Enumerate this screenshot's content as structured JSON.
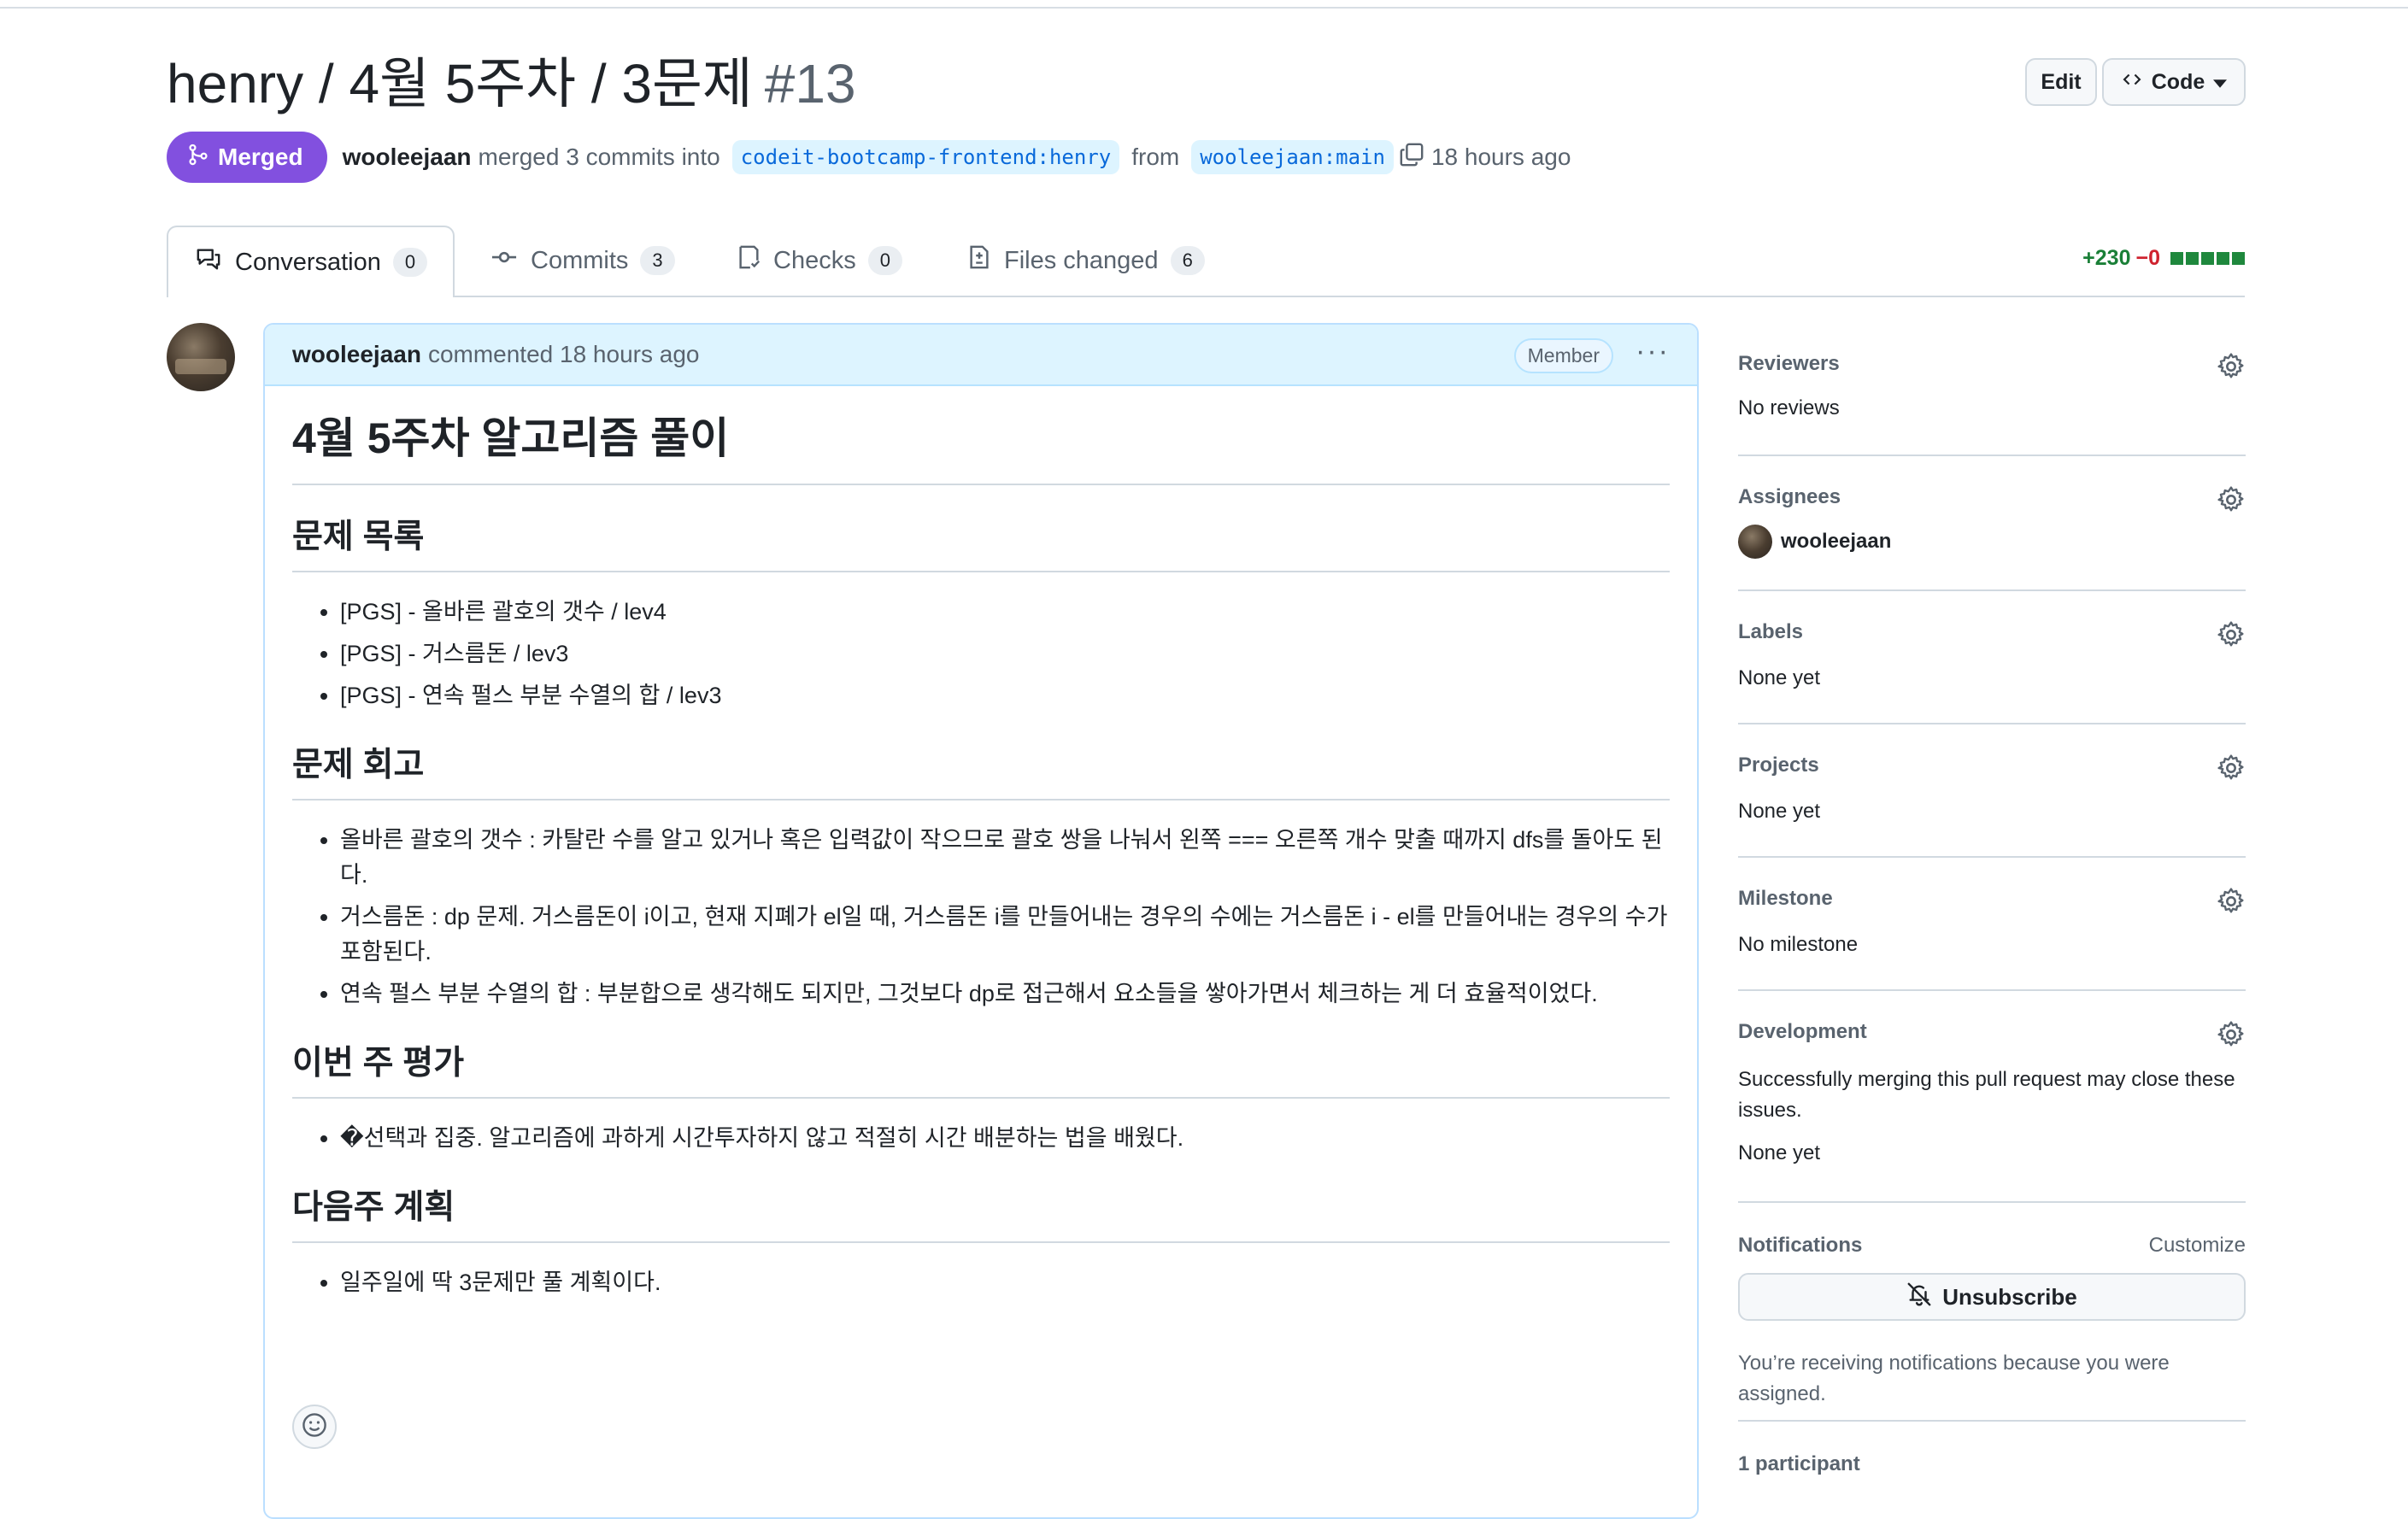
{
  "pr": {
    "title": "henry / 4월 5주차 / 3문제",
    "number": "#13",
    "status": "Merged",
    "author": "wooleejaan",
    "merged_text": "merged 3 commits into",
    "base_branch": "codeit-bootcamp-frontend:henry",
    "from_text": "from",
    "head_branch": "wooleejaan:main",
    "time": "18 hours ago",
    "edit_label": "Edit",
    "code_label": "Code"
  },
  "tabs": [
    {
      "label": "Conversation",
      "count": "0"
    },
    {
      "label": "Commits",
      "count": "3"
    },
    {
      "label": "Checks",
      "count": "0"
    },
    {
      "label": "Files changed",
      "count": "6"
    }
  ],
  "diffstat": {
    "additions": "+230",
    "deletions": "−0"
  },
  "comment": {
    "author": "wooleejaan",
    "action": "commented 18 hours ago",
    "badge": "Member",
    "h1": "4월 5주차 알고리즘 풀이",
    "sections": [
      {
        "heading": "문제 목록",
        "items": [
          "[PGS] - 올바른 괄호의 갯수 / lev4",
          "[PGS] - 거스름돈 / lev3",
          "[PGS] - 연속 펄스 부분 수열의 합 / lev3"
        ]
      },
      {
        "heading": "문제 회고",
        "items": [
          "올바른 괄호의 갯수 : 카탈란 수를 알고 있거나 혹은 입력값이 작으므로 괄호 쌍을 나눠서 왼쪽 === 오른쪽 개수 맞출 때까지 dfs를 돌아도 된다.",
          "거스름돈 : dp 문제. 거스름돈이 i이고, 현재 지폐가 el일 때, 거스름돈 i를 만들어내는 경우의 수에는 거스름돈 i - el를 만들어내는 경우의 수가 포함된다.",
          "연속 펄스 부분 수열의 합 : 부분합으로 생각해도 되지만, 그것보다 dp로 접근해서 요소들을 쌓아가면서 체크하는 게 더 효율적이었다."
        ]
      },
      {
        "heading": "이번 주 평가",
        "items": [
          "�선택과 집중. 알고리즘에 과하게 시간투자하지 않고 적절히 시간 배분하는 법을 배웠다."
        ]
      },
      {
        "heading": "다음주 계획",
        "items": [
          "일주일에 딱 3문제만 풀 계획이다."
        ]
      }
    ]
  },
  "sidebar": {
    "reviewers": {
      "title": "Reviewers",
      "value": "No reviews"
    },
    "assignees": {
      "title": "Assignees",
      "value": "wooleejaan"
    },
    "labels": {
      "title": "Labels",
      "value": "None yet"
    },
    "projects": {
      "title": "Projects",
      "value": "None yet"
    },
    "milestone": {
      "title": "Milestone",
      "value": "No milestone"
    },
    "development": {
      "title": "Development",
      "desc": "Successfully merging this pull request may close these issues.",
      "value": "None yet"
    },
    "notifications": {
      "title": "Notifications",
      "customize": "Customize",
      "button": "Unsubscribe",
      "note": "You’re receiving notifications because you were assigned."
    },
    "participants": {
      "title": "1 participant"
    }
  }
}
